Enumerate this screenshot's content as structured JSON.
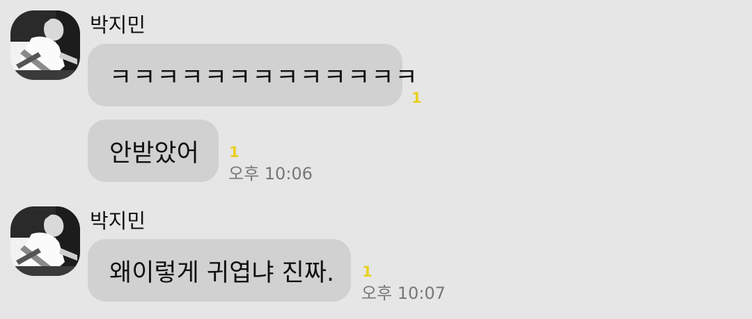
{
  "colors": {
    "background": "#e6e6e6",
    "bubble": "#d1d1d1",
    "unread_badge": "#e8d020",
    "timestamp": "#777777"
  },
  "groups": [
    {
      "sender": "박지민",
      "avatar_icon": "profile-photo-icon",
      "messages": [
        {
          "text": "ㅋㅋㅋㅋㅋㅋㅋㅋㅋㅋㅋㅋㅋ",
          "unread": "1",
          "time": ""
        },
        {
          "text": "안받았어",
          "unread": "1",
          "time": "오후 10:06"
        }
      ]
    },
    {
      "sender": "박지민",
      "avatar_icon": "profile-photo-icon",
      "messages": [
        {
          "text": "왜이렇게 귀엽냐 진짜.",
          "unread": "1",
          "time": "오후 10:07"
        }
      ]
    }
  ]
}
